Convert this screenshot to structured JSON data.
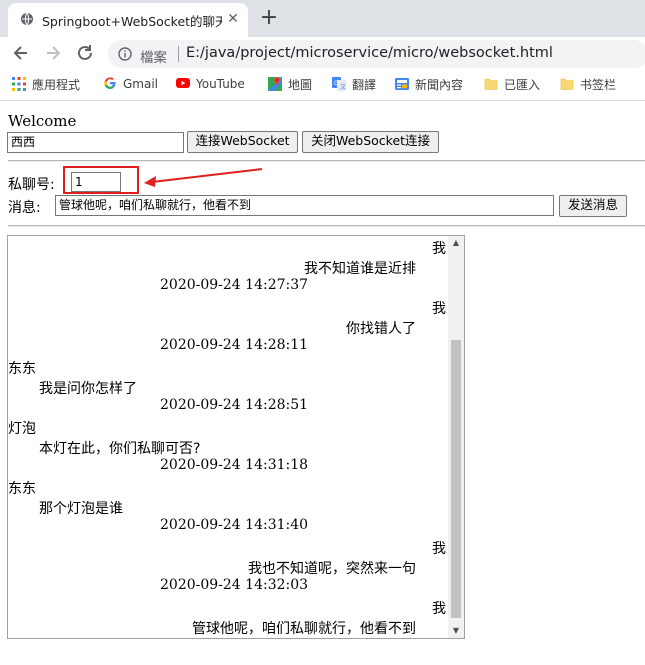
{
  "browser": {
    "tab_title": "Springboot+WebSocket的聊天",
    "tab_close": "✕",
    "new_tab": "+",
    "url_label": "檔案",
    "url": "E:/java/project/microservice/micro/websocket.html"
  },
  "bookmarks": [
    {
      "label": "應用程式",
      "icon": "apps-icon"
    },
    {
      "label": "Gmail",
      "icon": "google-icon"
    },
    {
      "label": "YouTube",
      "icon": "youtube-icon"
    },
    {
      "label": "地圖",
      "icon": "maps-icon"
    },
    {
      "label": "翻譯",
      "icon": "translate-icon"
    },
    {
      "label": "新聞內容",
      "icon": "news-icon"
    },
    {
      "label": "已匯入",
      "icon": "folder-icon"
    },
    {
      "label": "书签栏",
      "icon": "folder-icon"
    }
  ],
  "page": {
    "welcome": "Welcome",
    "username_value": "西西",
    "connect_button": "连接WebSocket",
    "close_button": "关闭WebSocket连接",
    "private_label": "私聊号:",
    "private_value": "1",
    "message_label": "消息:",
    "message_value": "管球他呢，咱们私聊就行，他看不到",
    "send_button": "发送消息"
  },
  "messages": [
    {
      "sender": "我",
      "text": "我不知道谁是近排",
      "time": "2020-09-24 14:27:37",
      "side": "right"
    },
    {
      "sender": "我",
      "text": "你找错人了",
      "time": "2020-09-24 14:28:11",
      "side": "right"
    },
    {
      "sender": "东东",
      "text": "我是问你怎样了",
      "time": "2020-09-24 14:28:51",
      "side": "left"
    },
    {
      "sender": "灯泡",
      "text": "本灯在此，你们私聊可否?",
      "time": "2020-09-24 14:31:18",
      "side": "left"
    },
    {
      "sender": "东东",
      "text": "那个灯泡是谁",
      "time": "2020-09-24 14:31:40",
      "side": "left"
    },
    {
      "sender": "我",
      "text": "我也不知道呢，突然来一句",
      "time": "2020-09-24 14:32:03",
      "side": "right"
    },
    {
      "sender": "我",
      "text": "管球他呢，咱们私聊就行，他看不到",
      "time": "",
      "side": "right"
    }
  ],
  "colors": {
    "annotation_red": "#e0201f",
    "tabstrip": "#dee1e6"
  }
}
